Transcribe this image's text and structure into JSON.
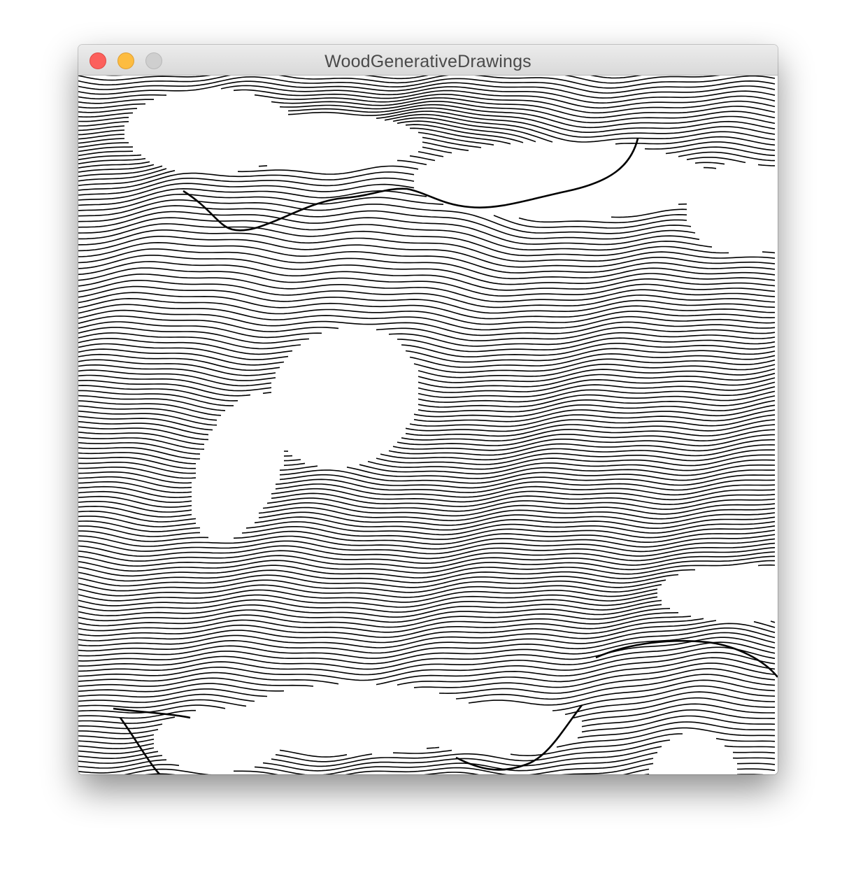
{
  "window": {
    "title": "WoodGenerativeDrawings",
    "controls": {
      "close_color": "#fc605c",
      "minimize_color": "#fdbc40",
      "zoom_color": "#cfcfcf"
    }
  },
  "canvas": {
    "content": "generative-wood-grain-drawing",
    "line_color": "#000000",
    "background_color": "#ffffff"
  }
}
